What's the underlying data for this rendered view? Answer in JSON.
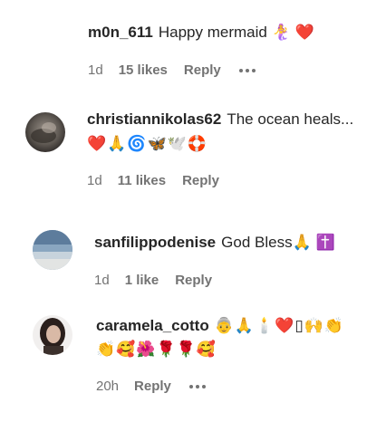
{
  "comments": [
    {
      "username": "m0n_611",
      "text": "Happy mermaid 🧜‍♀️ ❤️",
      "emoji_line": "",
      "time": "1d",
      "likes": "15 likes",
      "reply": "Reply",
      "has_more": true
    },
    {
      "username": "christiannikolas62",
      "text": "The ocean heals...",
      "emoji_line": "❤️🙏🌀🦋🕊️🛟",
      "time": "1d",
      "likes": "11 likes",
      "reply": "Reply",
      "has_more": false
    },
    {
      "username": "sanfilippodenise",
      "text": "God Bless🙏 ✝️",
      "emoji_line": "",
      "time": "1d",
      "likes": "1 like",
      "reply": "Reply",
      "has_more": false
    },
    {
      "username": "caramela_cotto",
      "text": "👵🙏🕯️❤️▯🙌👏",
      "emoji_line": "👏🥰🌺🌹🌹🥰",
      "time": "20h",
      "likes": "",
      "reply": "Reply",
      "has_more": true
    }
  ],
  "colors": {
    "text": "#262626",
    "meta": "#737373",
    "background": "#ffffff"
  }
}
